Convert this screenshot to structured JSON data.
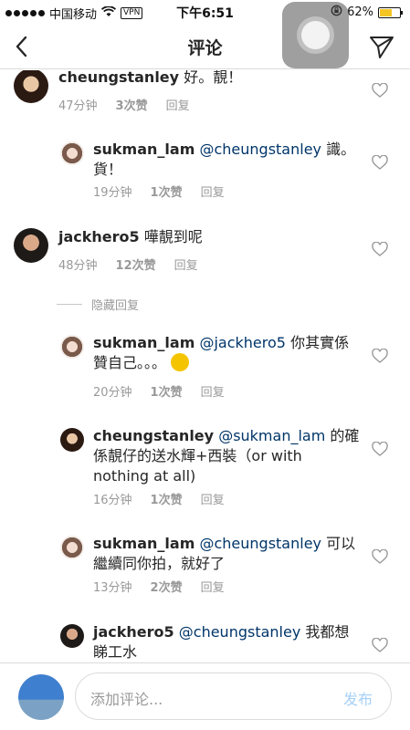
{
  "status": {
    "carrier": "中国移动",
    "vpn": "VPN",
    "time": "下午6:51",
    "battery": "62%",
    "battery_level": 0.62
  },
  "header": {
    "title": "评论"
  },
  "comments": [
    {
      "user": "cheungstanley",
      "text": "好。靚！",
      "time": "47分钟",
      "likes": "3次赞",
      "reply": "回复"
    },
    {
      "user": "sukman_lam",
      "mention": "@cheungstanley",
      "text": "識。",
      "text2": "貨！",
      "time": "19分钟",
      "likes": "1次赞",
      "reply": "回复"
    },
    {
      "user": "jackhero5",
      "text": "嘩靚到呢",
      "time": "48分钟",
      "likes": "12次赞",
      "reply": "回复"
    },
    {
      "user": "sukman_lam",
      "mention": "@jackhero5",
      "text": "你其實係",
      "text2": "贊自己。。。",
      "emoji": "smirk-emoji",
      "time": "20分钟",
      "likes": "1次赞",
      "reply": "回复"
    },
    {
      "user": "cheungstanley",
      "mention": "@sukman_lam",
      "text": "的確",
      "text2": "係靚仔的送水輝+西裝（or with",
      "text3": "nothing at all)",
      "time": "16分钟",
      "likes": "1次赞",
      "reply": "回复"
    },
    {
      "user": "sukman_lam",
      "mention": "@cheungstanley",
      "text": "可以",
      "text2": "繼續同你拍，就好了",
      "time": "13分钟",
      "likes": "2次赞",
      "reply": "回复"
    },
    {
      "user": "jackhero5",
      "mention": "@cheungstanley",
      "text": "我都想",
      "text2": "睇工水"
    }
  ],
  "hidden_replies": "隐藏回复",
  "composer": {
    "placeholder": "添加评论...",
    "post_label": "发布"
  }
}
